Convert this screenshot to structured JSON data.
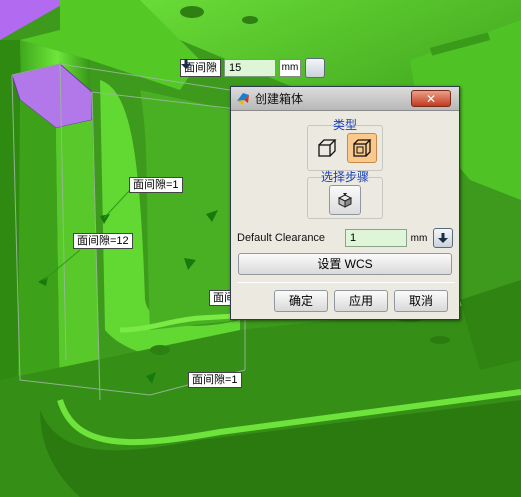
{
  "viewport": {
    "face_labels": [
      "面间隙=1",
      "面间隙=12",
      "面间隙=1",
      "面间"
    ],
    "top_clearance": {
      "label": "面间隙",
      "value": "15",
      "unit": "mm"
    }
  },
  "dialog": {
    "title": "创建箱体",
    "close_symbol": "✕",
    "type_group": {
      "title": "类型",
      "options": [
        "box-wireframe-icon",
        "box-offset-icon"
      ],
      "selected": "box-offset-icon"
    },
    "step_group": {
      "title": "选择步骤",
      "icon": "select-face-icon"
    },
    "clearance": {
      "label": "Default Clearance",
      "value": "1",
      "unit": "mm"
    },
    "wcs_button": "设置 WCS",
    "buttons": {
      "ok": "确定",
      "apply": "应用",
      "cancel": "取消"
    }
  }
}
